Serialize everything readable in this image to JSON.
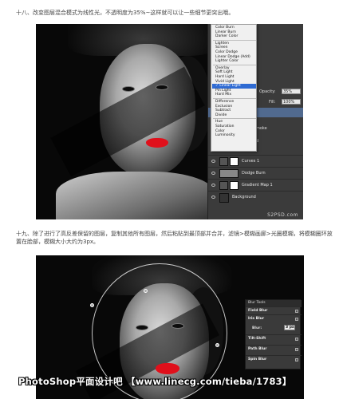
{
  "paragraphs": {
    "p1": "十八、改变图层混合模式为线性光，不透明度为35%~这样就可以让一些细节更突出哦。",
    "p2": "十九、除了进行了高反差保留的图层，复制其他所有图层，然后粘贴到最顶部并合并，滤镜>模糊画廊>光圈模糊，将模糊圈环放置在脸部，模糊大小大约为3px。"
  },
  "layers_panel": {
    "opacity_label": "Opacity:",
    "opacity_value": "35%",
    "fill_label": "Fill:",
    "fill_value": "100%",
    "layers": [
      {
        "name": "Curves 1",
        "type": "adjustment"
      },
      {
        "name": "Dodge Burn",
        "type": "pixel"
      },
      {
        "name": "Gradient Map 1",
        "type": "adjustment"
      },
      {
        "name": "Background",
        "type": "image"
      }
    ],
    "partial_layer_1": "moke",
    "partial_layer_2": "d"
  },
  "blend_menu": {
    "group1": [
      "Color Burn",
      "Linear Burn",
      "Darker Color"
    ],
    "group2": [
      "Lighten",
      "Screen",
      "Color Dodge",
      "Linear Dodge (Add)",
      "Lighter Color"
    ],
    "group3": [
      "Overlay",
      "Soft Light",
      "Hard Light",
      "Vivid Light",
      "Linear Light",
      "Pin Light",
      "Hard Mix"
    ],
    "group4": [
      "Difference",
      "Exclusion",
      "Subtract",
      "Divide"
    ],
    "group5": [
      "Hue",
      "Saturation",
      "Color",
      "Luminosity"
    ],
    "selected": "Linear Light"
  },
  "watermark1": "S2PSD.com",
  "blur_tools": {
    "title": "Blur Tools",
    "sections": [
      "Field Blur",
      "Iris Blur",
      "Tilt-Shift",
      "Path Blur",
      "Spin Blur"
    ],
    "blur_label": "Blur:",
    "blur_value": "3 px"
  },
  "caption": "PhotoShop平面设计吧 【www.linecg.com/tieba/1783】",
  "colors": {
    "accent": "#2f6bd3",
    "lips": "#e0101b"
  }
}
